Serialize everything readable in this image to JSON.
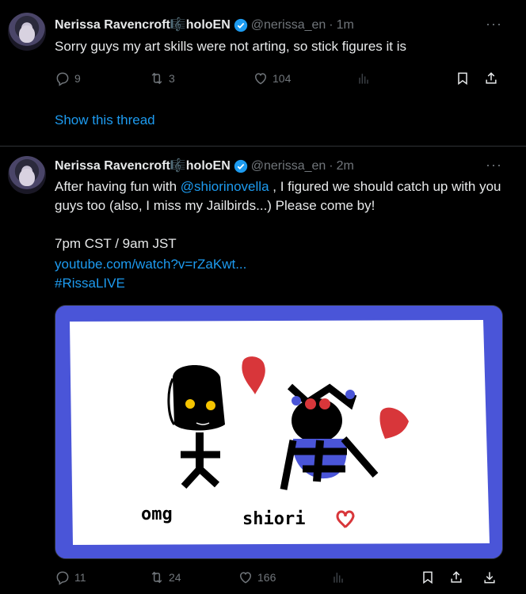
{
  "tweets": [
    {
      "name": "Nerissa Ravencroft🎼holoEN",
      "handle": "@nerissa_en",
      "dot": "·",
      "time": "1m",
      "text": "Sorry guys my art skills were not arting, so stick figures it is",
      "replies": "9",
      "retweets": "3",
      "likes": "104",
      "show_thread": "Show this thread"
    },
    {
      "name": "Nerissa Ravencroft🎼holoEN",
      "handle": "@nerissa_en",
      "dot": "·",
      "time": "2m",
      "text_pre": "After having fun with ",
      "mention": "@shiorinovella",
      "text_post": " , I figured we should catch up with you guys too (also, I miss my Jailbirds...) Please come by!",
      "schedule": "7pm CST / 9am JST",
      "url": "youtube.com/watch?v=rZaKwt...",
      "hashtag": "#RissaLIVE",
      "media_caption": [
        "omg",
        "shiori"
      ],
      "replies": "11",
      "retweets": "24",
      "likes": "166"
    }
  ],
  "more_glyph": "···",
  "colors": {
    "accent": "#1d9bf0",
    "muted": "#71767b",
    "bg": "#000000",
    "media_border": "#4a55d8"
  }
}
